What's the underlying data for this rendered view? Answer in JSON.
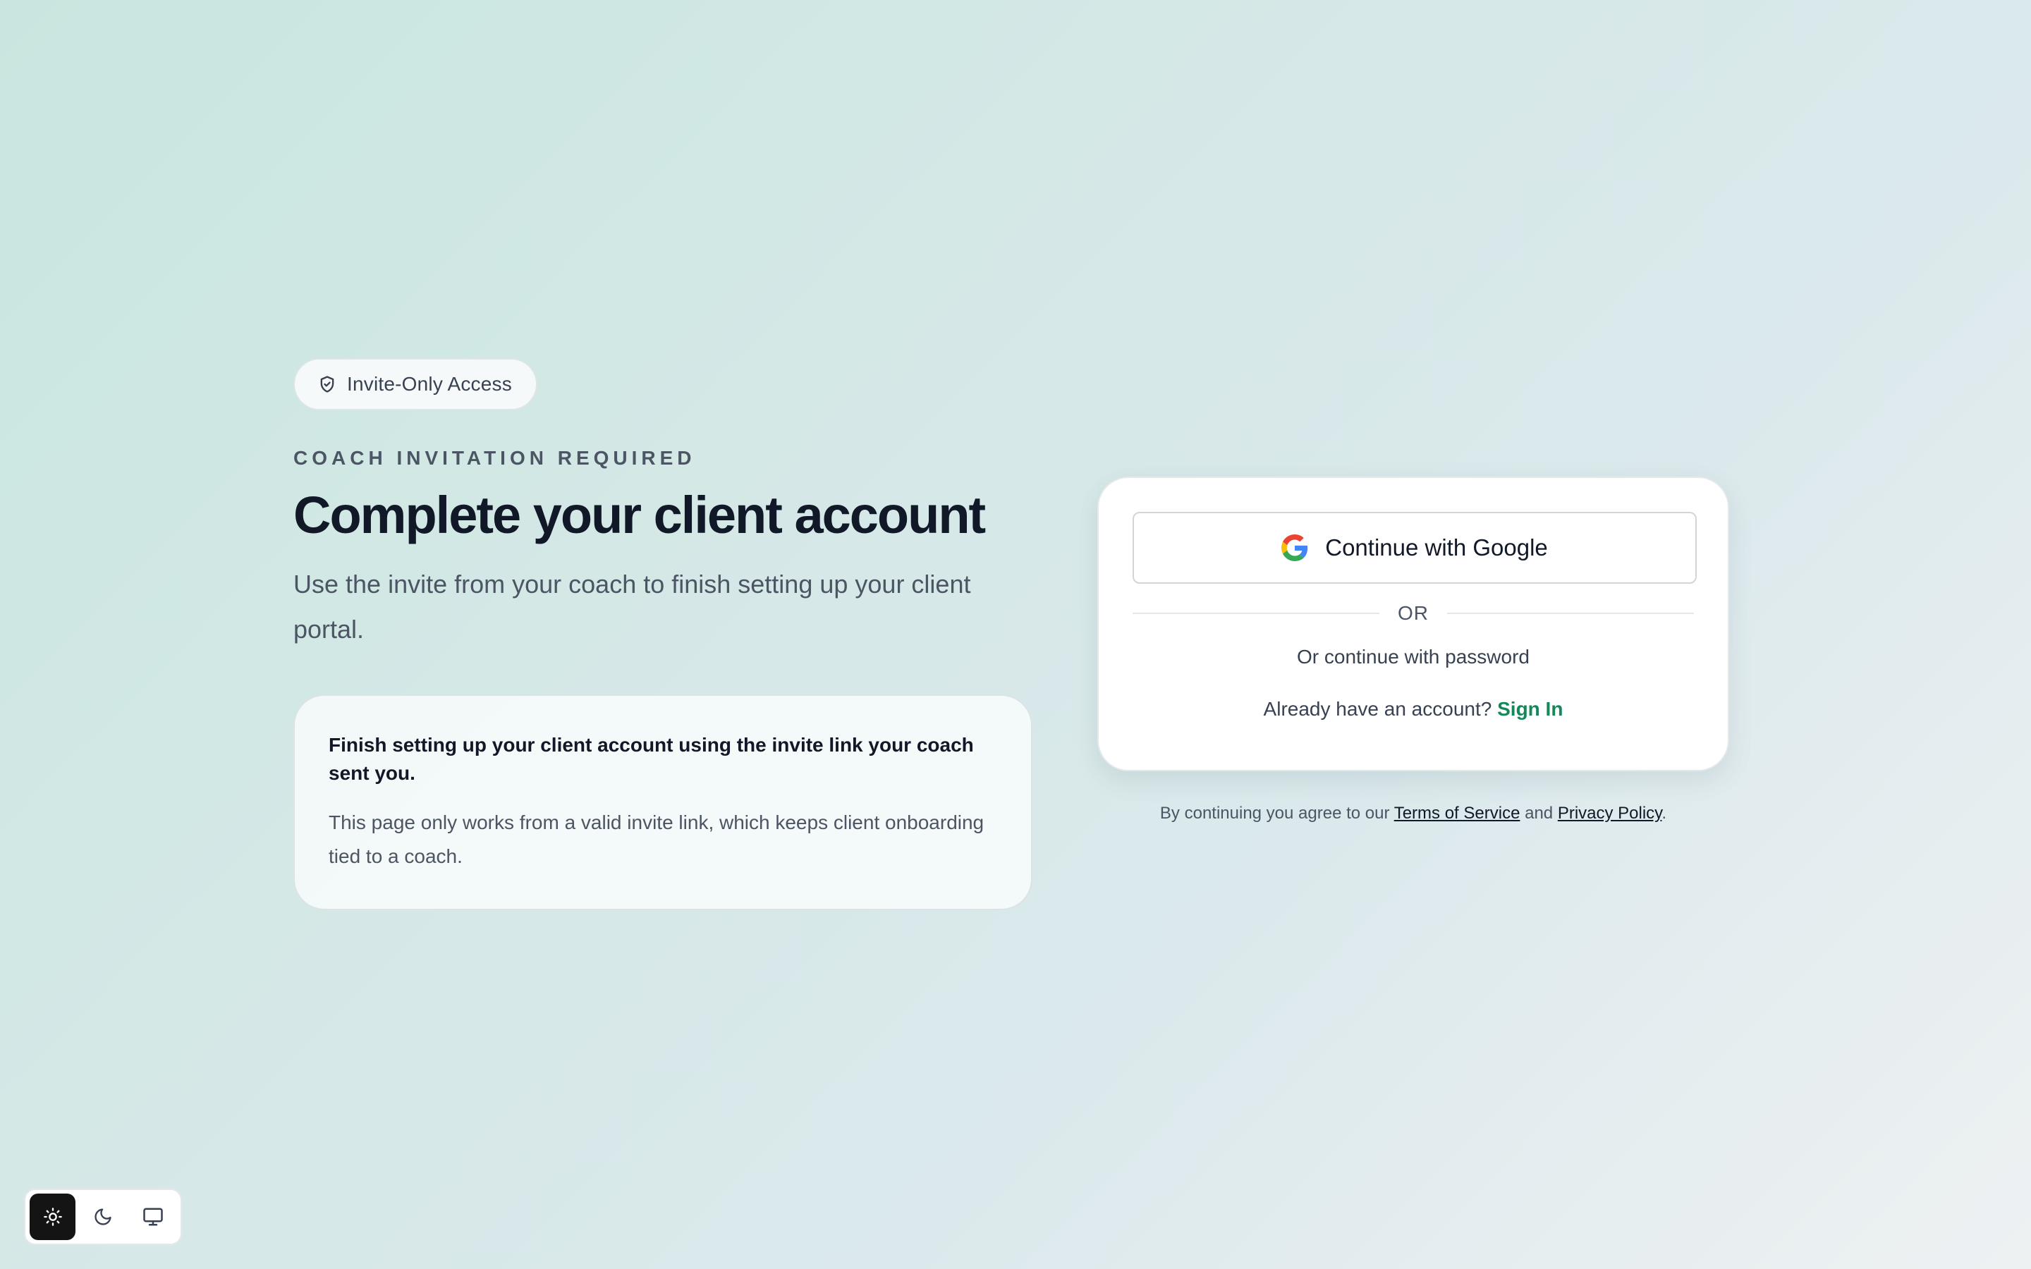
{
  "badge": {
    "label": "Invite-Only Access",
    "icon": "shield-check-icon"
  },
  "hero": {
    "eyebrow": "COACH INVITATION REQUIRED",
    "title": "Complete your client account",
    "subtitle": "Use the invite from your coach to finish setting up your client portal."
  },
  "info_card": {
    "title": "Finish setting up your client account using the invite link your coach sent you.",
    "body": "This page only works from a valid invite link, which keeps client onboarding tied to a coach."
  },
  "auth": {
    "google_label": "Continue with Google",
    "divider": "OR",
    "password_link": "Or continue with password",
    "signin_prompt": "Already have an account?",
    "signin_link": "Sign In"
  },
  "legal": {
    "prefix": "By continuing you agree to our",
    "terms": "Terms of Service",
    "and": "and",
    "privacy": "Privacy Policy",
    "suffix": "."
  },
  "theme_switcher": {
    "options": [
      "sun-icon",
      "moon-icon",
      "monitor-icon"
    ],
    "active": "sun-icon"
  },
  "colors": {
    "accent": "#14885a",
    "text_primary": "#111827",
    "text_secondary": "#4b5563",
    "active_theme_bg": "#141414"
  }
}
